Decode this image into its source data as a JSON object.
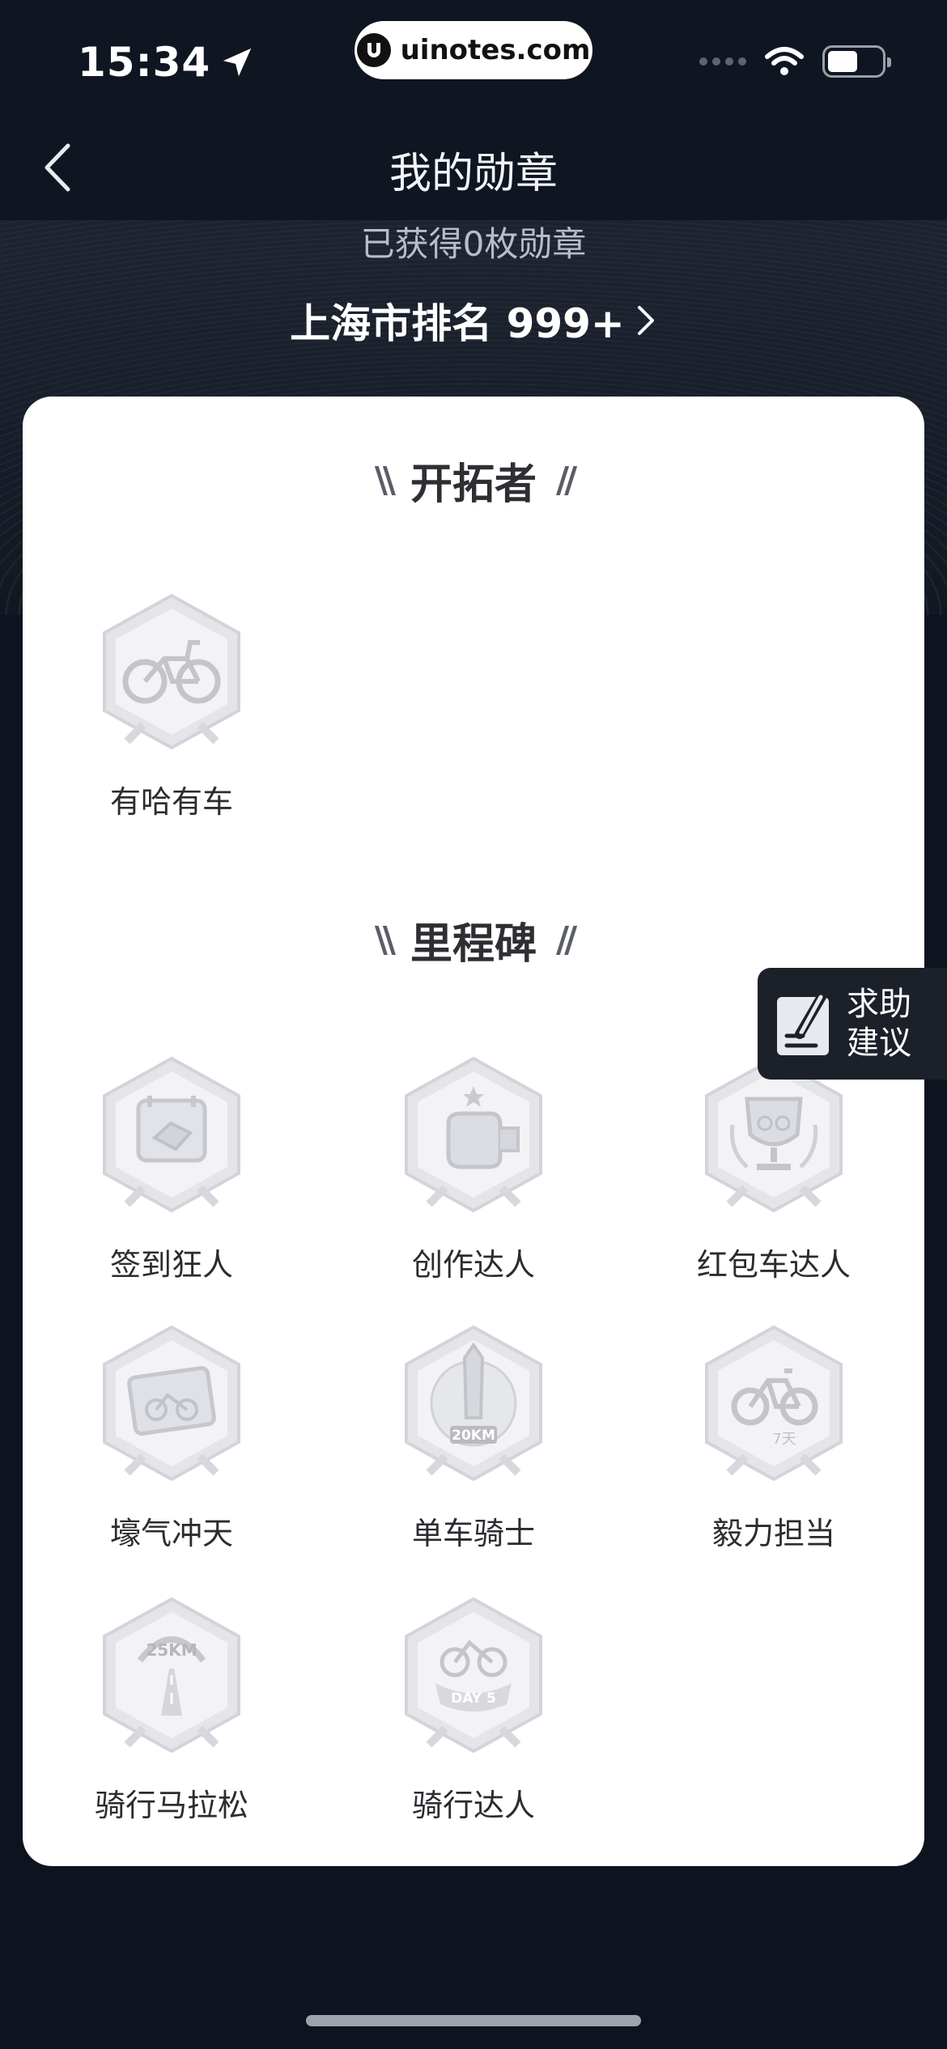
{
  "status": {
    "time": "15:34",
    "url": "uinotes.com",
    "battery_level": 0.56
  },
  "nav": {
    "title": "我的勋章"
  },
  "summary": {
    "count_text": "已获得0枚勋章",
    "rank_text": "上海市排名 999+"
  },
  "sections": [
    {
      "title": "开拓者",
      "badges": [
        {
          "label": "有哈有车",
          "icon": "bike-icon"
        }
      ]
    },
    {
      "title": "里程碑",
      "badges": [
        {
          "label": "签到狂人",
          "icon": "calendar-icon"
        },
        {
          "label": "创作达人",
          "icon": "pen-hand-icon"
        },
        {
          "label": "红包车达人",
          "icon": "trophy-icon"
        },
        {
          "label": "壕气冲天",
          "icon": "card-bike-icon"
        },
        {
          "label": "单车骑士",
          "icon": "sword-20km-icon"
        },
        {
          "label": "毅力担当",
          "icon": "bike-7days-icon"
        },
        {
          "label": "骑行马拉松",
          "icon": "road-25km-icon"
        },
        {
          "label": "骑行达人",
          "icon": "bike-day5-icon"
        }
      ]
    }
  ],
  "badge_texts": {
    "sword": "20KM",
    "marathon": "25KM",
    "day": "DAY 5",
    "persist": "7天"
  },
  "help": {
    "line1": "求助",
    "line2": "建议"
  }
}
